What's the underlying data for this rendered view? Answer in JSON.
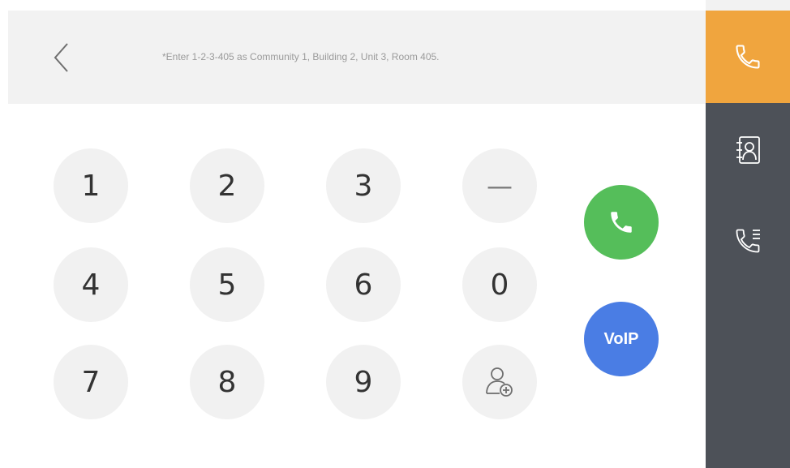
{
  "header": {
    "hint": "*Enter 1-2-3-405 as Community 1, Building 2, Unit 3, Room 405.",
    "back_icon": "chevron-left-icon"
  },
  "keypad": {
    "keys": [
      "1",
      "2",
      "3",
      "—",
      "4",
      "5",
      "6",
      "0",
      "7",
      "8",
      "9"
    ],
    "add_contact_icon": "add-contact-icon"
  },
  "actions": {
    "call_icon": "phone-icon",
    "voip_label": "VoIP"
  },
  "sidebar": {
    "items": [
      {
        "icon": "phone-icon",
        "active": true
      },
      {
        "icon": "contacts-icon",
        "active": false
      },
      {
        "icon": "call-log-icon",
        "active": false
      }
    ]
  },
  "colors": {
    "accent": "#f0a53e",
    "sidebar": "#4d5158",
    "call": "#55be5a",
    "voip": "#4a7de4",
    "key_bg": "#f1f1f1"
  }
}
